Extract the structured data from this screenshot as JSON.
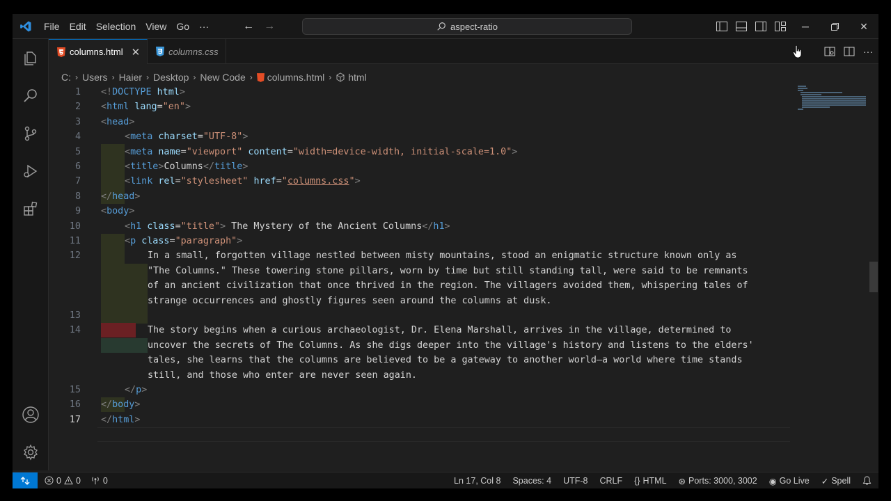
{
  "menu": {
    "file": "File",
    "edit": "Edit",
    "selection": "Selection",
    "view": "View",
    "go": "Go",
    "more": "···"
  },
  "search": {
    "text": "aspect-ratio"
  },
  "tabs": [
    {
      "label": "columns.html",
      "icon": "html5-icon"
    },
    {
      "label": "columns.css",
      "icon": "css3-icon"
    }
  ],
  "breadcrumb": {
    "c": "C:",
    "users": "Users",
    "haier": "Haier",
    "desktop": "Desktop",
    "newcode": "New Code",
    "file": "columns.html",
    "element": "html"
  },
  "lines": {
    "l1": "1",
    "l2": "2",
    "l3": "3",
    "l4": "4",
    "l5": "5",
    "l6": "6",
    "l7": "7",
    "l8": "8",
    "l9": "9",
    "l10": "10",
    "l11": "11",
    "l12": "12",
    "l13": "13",
    "l14": "14",
    "l15": "15",
    "l16": "16",
    "l17": "17"
  },
  "code": {
    "c1_a": "<!",
    "c1_b": "DOCTYPE",
    "c1_c": " html",
    "c1_d": ">",
    "c2_tag": "html",
    "c2_attr": "lang",
    "c2_val": "\"en\"",
    "c3_tag": "head",
    "c4_tag": "meta",
    "c4_attr": "charset",
    "c4_val": "\"UTF-8\"",
    "c5_tag": "meta",
    "c5_attr1": "name",
    "c5_val1": "\"viewport\"",
    "c5_attr2": "content",
    "c5_val2": "\"width=device-width, initial-scale=1.0\"",
    "c6_tag": "title",
    "c6_text": "Columns",
    "c7_tag": "link",
    "c7_attr1": "rel",
    "c7_val1": "\"stylesheet\"",
    "c7_attr2": "href",
    "c7_q1": "\"",
    "c7_val2": "columns.css",
    "c7_q2": "\"",
    "c8_tag": "head",
    "c9_tag": "body",
    "c10_tag": "h1",
    "c10_attr": "class",
    "c10_val": "\"title\"",
    "c10_text": " The Mystery of the Ancient Columns",
    "c11_tag": "p",
    "c11_attr": "class",
    "c11_val": "\"paragraph\"",
    "p1": [
      "In a small, forgotten village nestled between misty mountains, stood an enigmatic structure known only as",
      "\"The Columns.\" These towering stone pillars, worn by time but still standing tall, were said to be remnants",
      "of an ancient civilization that once thrived in the region. The villagers avoided them, whispering tales of",
      "strange occurrences and ghostly figures seen around the columns at dusk."
    ],
    "p2": [
      "The story begins when a curious archaeologist, Dr. Elena Marshall, arrives in the village, determined to",
      "uncover the secrets of The Columns. As she digs deeper into the village's history and listens to the elders'",
      "tales, she learns that the columns are believed to be a gateway to another world—a world where time stands",
      "still, and those who enter are never seen again."
    ],
    "c15_tag": "p",
    "c16_tag": "body",
    "c17_tag": "html"
  },
  "status": {
    "errors": "0",
    "warnings": "0",
    "ports_count": "0",
    "position": "Ln 17, Col 8",
    "spaces": "Spaces: 4",
    "encoding": "UTF-8",
    "eol": "CRLF",
    "language": "HTML",
    "ports": "Ports: 3000, 3002",
    "golive": "Go Live",
    "spell": "Spell"
  }
}
